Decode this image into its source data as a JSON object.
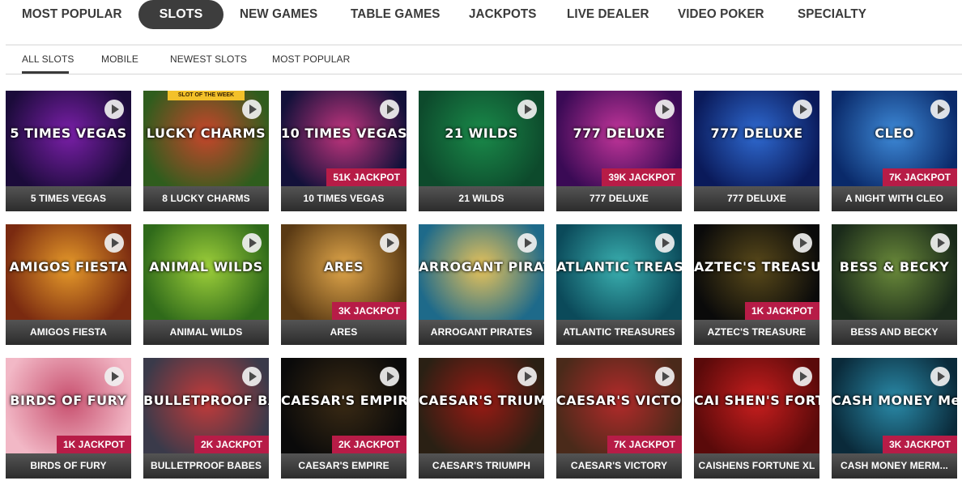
{
  "top_nav": [
    {
      "label": "MOST POPULAR",
      "active": false
    },
    {
      "label": "SLOTS",
      "active": true
    },
    {
      "label": "NEW GAMES",
      "active": false
    },
    {
      "label": "TABLE GAMES",
      "active": false
    },
    {
      "label": "JACKPOTS",
      "active": false
    },
    {
      "label": "LIVE DEALER",
      "active": false
    },
    {
      "label": "VIDEO POKER",
      "active": false
    },
    {
      "label": "SPECIALTY",
      "active": false
    }
  ],
  "sub_nav": [
    {
      "label": "ALL SLOTS",
      "active": true
    },
    {
      "label": "MOBILE",
      "active": false
    },
    {
      "label": "NEWEST SLOTS",
      "active": false
    },
    {
      "label": "MOST POPULAR",
      "active": false
    }
  ],
  "games": [
    {
      "name": "5 TIMES VEGAS",
      "jackpot": "",
      "logo": "5 TIMES VEGAS",
      "colors": [
        "#1b0b3a",
        "#7a1fa8"
      ]
    },
    {
      "name": "8 LUCKY CHARMS",
      "jackpot": "",
      "logo": "LUCKY CHARMS",
      "colors": [
        "#2f5d1d",
        "#c8452b"
      ],
      "badge": "SLOT OF THE WEEK"
    },
    {
      "name": "10 TIMES VEGAS",
      "jackpot": "51K JACKPOT",
      "logo": "10 TIMES VEGAS",
      "colors": [
        "#13113a",
        "#c2357e"
      ]
    },
    {
      "name": "21 WILDS",
      "jackpot": "",
      "logo": "21 WILDS",
      "colors": [
        "#0d4a2c",
        "#1a8a4a"
      ]
    },
    {
      "name": "777 DELUXE",
      "jackpot": "39K JACKPOT",
      "logo": "777 DELUXE",
      "colors": [
        "#3a0a55",
        "#c2359a"
      ]
    },
    {
      "name": "777 DELUXE",
      "jackpot": "",
      "logo": "777 DELUXE",
      "colors": [
        "#0a1a5a",
        "#2f6ad1"
      ]
    },
    {
      "name": "A NIGHT WITH CLEO",
      "jackpot": "7K JACKPOT",
      "logo": "CLEO",
      "colors": [
        "#0a2a6a",
        "#3e8ad8"
      ]
    },
    {
      "name": "AMIGOS FIESTA",
      "jackpot": "",
      "logo": "AMIGOS FIESTA",
      "colors": [
        "#7a2a10",
        "#e69a2a"
      ]
    },
    {
      "name": "ANIMAL WILDS",
      "jackpot": "",
      "logo": "ANIMAL WILDS",
      "colors": [
        "#2f6a1a",
        "#9ed03a"
      ]
    },
    {
      "name": "ARES",
      "jackpot": "3K JACKPOT",
      "logo": "ARES",
      "colors": [
        "#5a3a14",
        "#e0a64a"
      ]
    },
    {
      "name": "ARROGANT PIRATES",
      "jackpot": "",
      "logo": "ARROGANT PIRATES",
      "colors": [
        "#1e6a8a",
        "#e8c35a"
      ]
    },
    {
      "name": "ATLANTIC TREASURES",
      "jackpot": "",
      "logo": "ATLANTIC TREASURES",
      "colors": [
        "#0b4a5a",
        "#3ab0b0"
      ]
    },
    {
      "name": "AZTEC'S TREASURE",
      "jackpot": "1K JACKPOT",
      "logo": "AZTEC'S TREASURE",
      "colors": [
        "#0a0a0a",
        "#5a4a1a"
      ]
    },
    {
      "name": "BESS AND BECKY",
      "jackpot": "",
      "logo": "BESS & BECKY",
      "colors": [
        "#1a2a1a",
        "#6a8a3a"
      ]
    },
    {
      "name": "BIRDS OF FURY",
      "jackpot": "1K JACKPOT",
      "logo": "BIRDS OF FURY",
      "colors": [
        "#f2b8c6",
        "#c74f6e"
      ]
    },
    {
      "name": "BULLETPROOF BABES",
      "jackpot": "2K JACKPOT",
      "logo": "BULLETPROOF BABES",
      "colors": [
        "#3a3a4a",
        "#c33a3a"
      ]
    },
    {
      "name": "CAESAR'S EMPIRE",
      "jackpot": "2K JACKPOT",
      "logo": "CAESAR'S EMPIRE",
      "colors": [
        "#0a0a0a",
        "#3a2a14"
      ]
    },
    {
      "name": "CAESAR'S TRIUMPH",
      "jackpot": "",
      "logo": "CAESAR'S TRIUMPH",
      "colors": [
        "#2a2014",
        "#9a1a14"
      ]
    },
    {
      "name": "CAESAR'S VICTORY",
      "jackpot": "7K JACKPOT",
      "logo": "CAESAR'S VICTORY",
      "colors": [
        "#4a2a1a",
        "#b32a2a"
      ]
    },
    {
      "name": "CAISHENS FORTUNE XL",
      "jackpot": "",
      "logo": "CAI SHEN'S FORTUNE",
      "colors": [
        "#5a0a0a",
        "#c81e1e"
      ]
    },
    {
      "name": "CASH MONEY MERM...",
      "jackpot": "3K JACKPOT",
      "logo": "CASH MONEY Mermaids",
      "colors": [
        "#0a2a3a",
        "#2a8aa8"
      ]
    }
  ],
  "icons": {
    "play": "play-icon"
  }
}
